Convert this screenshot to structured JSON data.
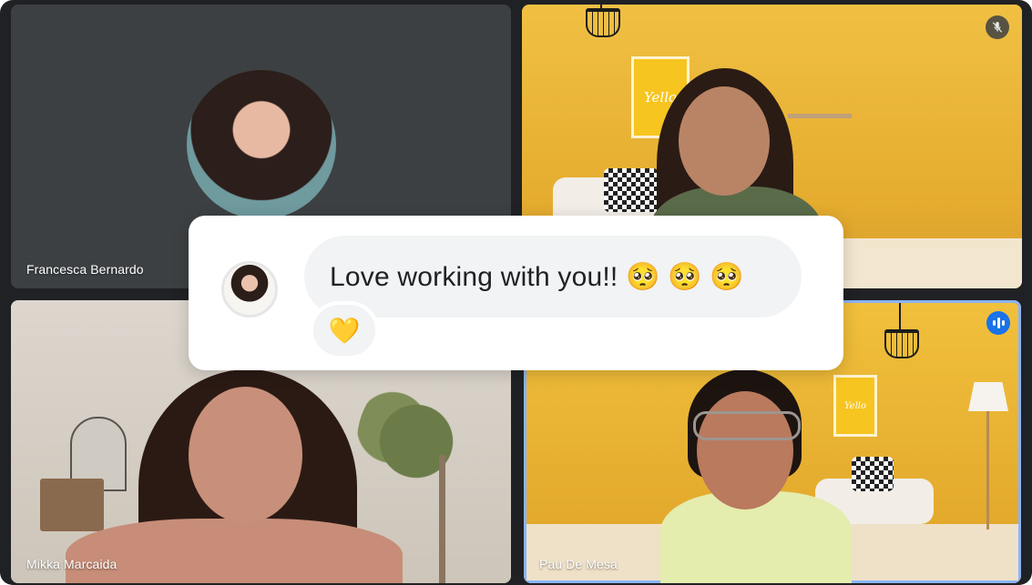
{
  "participants": [
    {
      "name": "Francesca Bernardo",
      "video": "off"
    },
    {
      "name": "",
      "video": "on",
      "muted": true
    },
    {
      "name": "Mikka Marcaida",
      "video": "on"
    },
    {
      "name": "Pau De Mesa",
      "video": "on",
      "speaking": true
    }
  ],
  "posters": {
    "top_right": "Yello",
    "bottom_right": "Yello"
  },
  "chat": {
    "message": "Love working with you!! 🥺 🥺 🥺",
    "reaction": "💛"
  },
  "icons": {
    "mute": "mic-off-icon",
    "speaking": "audio-level-icon"
  },
  "colors": {
    "grid_background": "#202124",
    "tile_off": "#3c4043",
    "active_border": "#8ab4f8",
    "speaking_badge": "#1a73e8",
    "bubble": "#f1f3f4"
  }
}
